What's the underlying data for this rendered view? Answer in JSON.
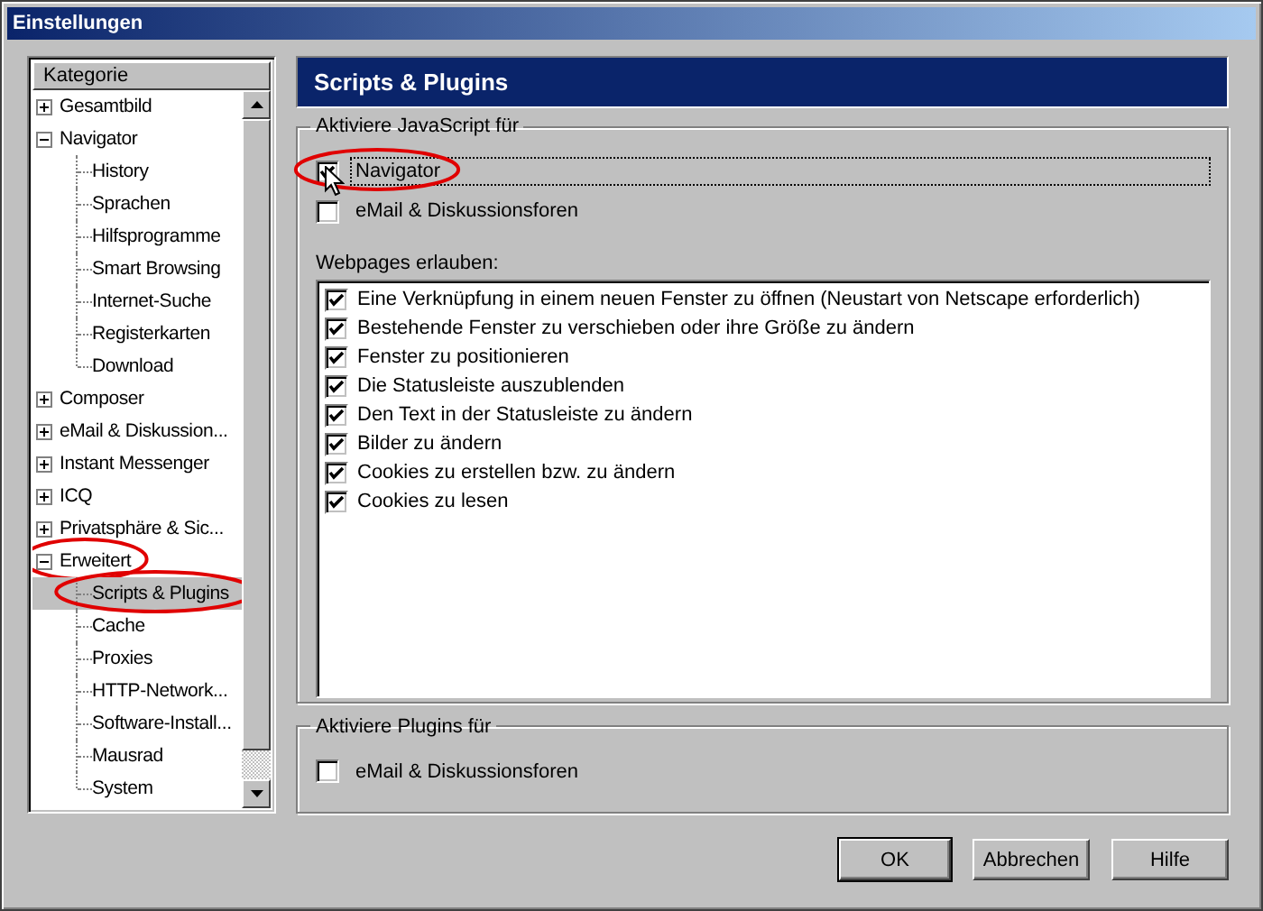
{
  "window": {
    "title": "Einstellungen"
  },
  "sidebar": {
    "header": "Kategorie",
    "items": [
      {
        "label": "Gesamtbild",
        "expanded": false,
        "selected": false,
        "circled": false
      },
      {
        "label": "Navigator",
        "expanded": true,
        "selected": false,
        "circled": false,
        "children": [
          {
            "label": "History",
            "selected": false,
            "circled": false
          },
          {
            "label": "Sprachen",
            "selected": false,
            "circled": false
          },
          {
            "label": "Hilfsprogramme",
            "selected": false,
            "circled": false
          },
          {
            "label": "Smart Browsing",
            "selected": false,
            "circled": false
          },
          {
            "label": "Internet-Suche",
            "selected": false,
            "circled": false
          },
          {
            "label": "Registerkarten",
            "selected": false,
            "circled": false
          },
          {
            "label": "Download",
            "selected": false,
            "circled": false
          }
        ]
      },
      {
        "label": "Composer",
        "expanded": false,
        "selected": false,
        "circled": false
      },
      {
        "label": "eMail & Diskussion...",
        "expanded": false,
        "selected": false,
        "circled": false
      },
      {
        "label": "Instant Messenger",
        "expanded": false,
        "selected": false,
        "circled": false
      },
      {
        "label": "ICQ",
        "expanded": false,
        "selected": false,
        "circled": false
      },
      {
        "label": "Privatsphäre & Sic...",
        "expanded": false,
        "selected": false,
        "circled": false
      },
      {
        "label": "Erweitert",
        "expanded": true,
        "selected": false,
        "circled": true,
        "children": [
          {
            "label": "Scripts & Plugins",
            "selected": true,
            "circled": true
          },
          {
            "label": "Cache",
            "selected": false,
            "circled": false
          },
          {
            "label": "Proxies",
            "selected": false,
            "circled": false
          },
          {
            "label": "HTTP-Network...",
            "selected": false,
            "circled": false
          },
          {
            "label": "Software-Install...",
            "selected": false,
            "circled": false
          },
          {
            "label": "Mausrad",
            "selected": false,
            "circled": false
          },
          {
            "label": "System",
            "selected": false,
            "circled": false
          }
        ]
      }
    ]
  },
  "panel": {
    "title": "Scripts & Plugins",
    "javascript_group": {
      "label": "Aktiviere JavaScript für",
      "options": [
        {
          "label": "Navigator",
          "checked": true,
          "focused": true,
          "circled": true
        },
        {
          "label": "eMail & Diskussionsforen",
          "checked": false,
          "focused": false,
          "circled": false
        }
      ],
      "permissions_label": "Webpages erlauben:",
      "permissions": [
        {
          "label": "Eine Verknüpfung in einem neuen Fenster zu öffnen (Neustart von Netscape erforderlich)",
          "checked": true
        },
        {
          "label": "Bestehende Fenster zu verschieben oder ihre Größe zu ändern",
          "checked": true
        },
        {
          "label": "Fenster zu positionieren",
          "checked": true
        },
        {
          "label": "Die Statusleiste auszublenden",
          "checked": true
        },
        {
          "label": "Den Text in der Statusleiste zu ändern",
          "checked": true
        },
        {
          "label": "Bilder zu ändern",
          "checked": true
        },
        {
          "label": "Cookies zu erstellen bzw. zu ändern",
          "checked": true
        },
        {
          "label": "Cookies zu lesen",
          "checked": true
        }
      ]
    },
    "plugins_group": {
      "label": "Aktiviere Plugins für",
      "options": [
        {
          "label": "eMail & Diskussionsforen",
          "checked": false
        }
      ]
    }
  },
  "buttons": [
    {
      "label": "OK",
      "default": true
    },
    {
      "label": "Abbrechen",
      "default": false
    },
    {
      "label": "Hilfe",
      "default": false
    }
  ]
}
